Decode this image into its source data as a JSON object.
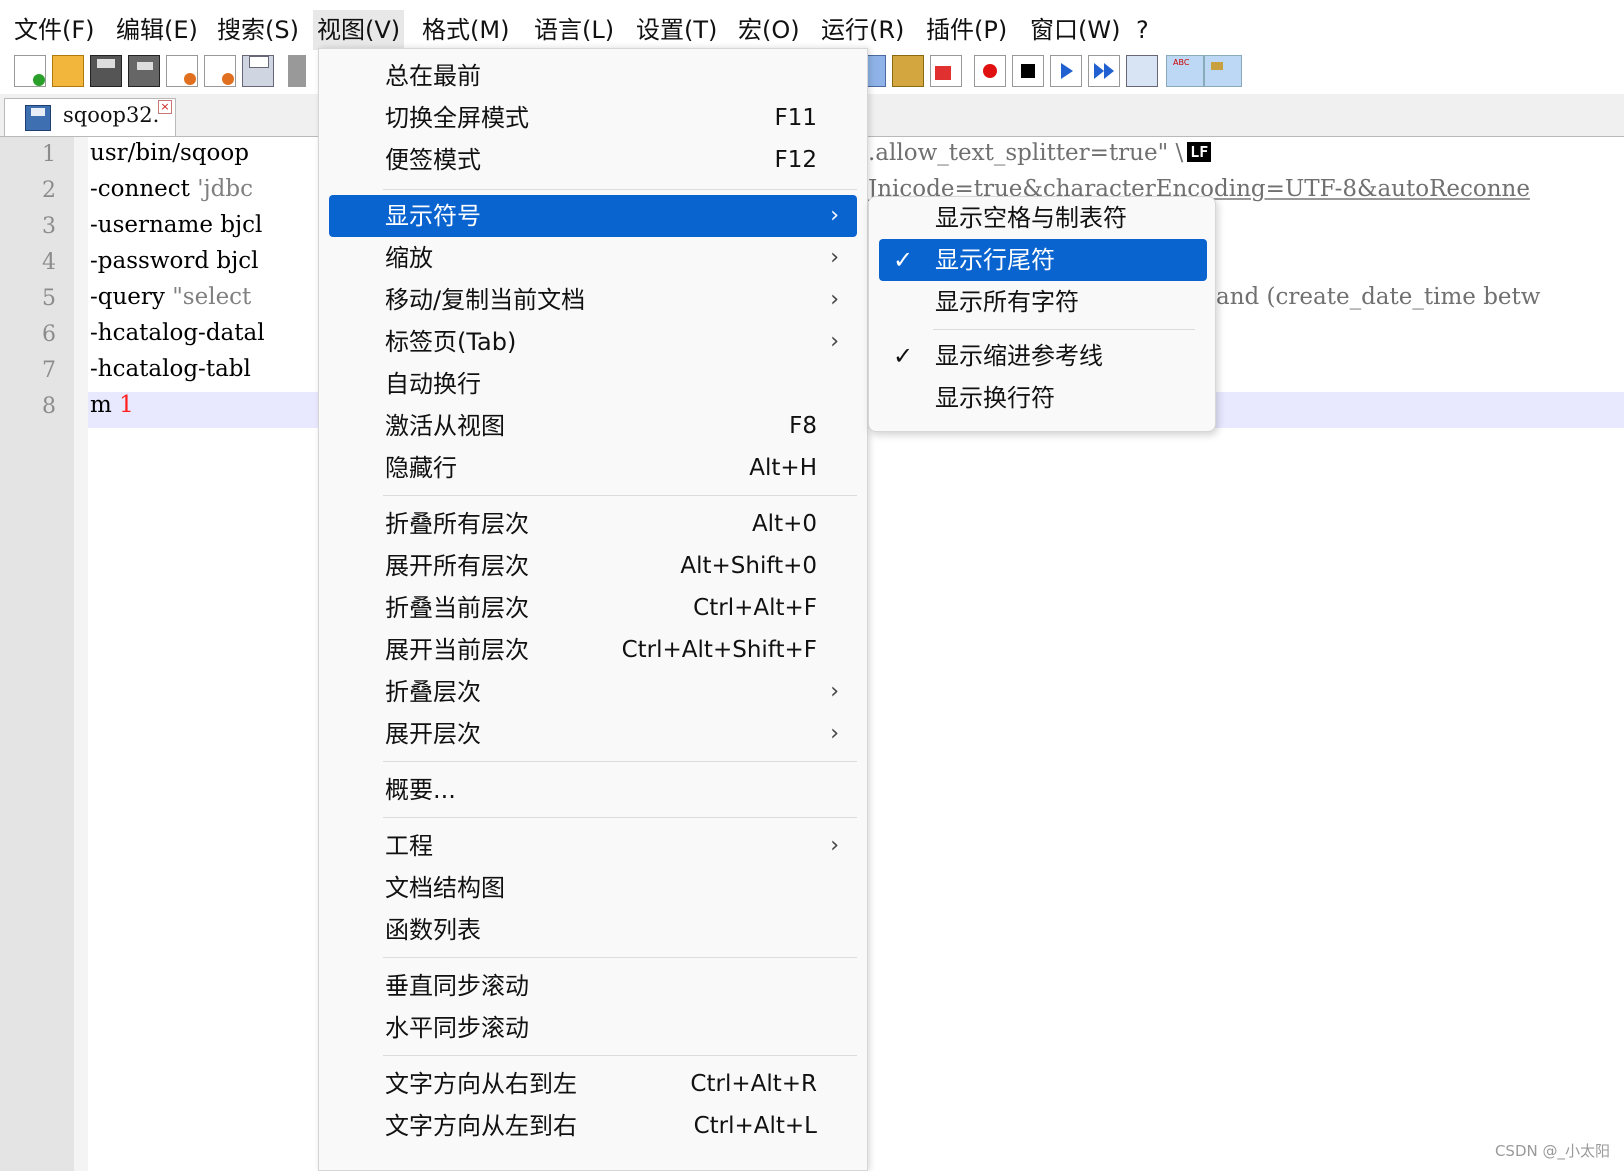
{
  "menubar": {
    "items": [
      "文件(F)",
      "编辑(E)",
      "搜索(S)",
      "视图(V)",
      "格式(M)",
      "语言(L)",
      "设置(T)",
      "宏(O)",
      "运行(R)",
      "插件(P)",
      "窗口(W)",
      "?"
    ]
  },
  "tab": {
    "name": "sqoop32."
  },
  "editor": {
    "line_numbers": [
      "1",
      "2",
      "3",
      "4",
      "5",
      "6",
      "7",
      "8"
    ],
    "lines": [
      {
        "a": "usr/bin/sqoop",
        "b": ""
      },
      {
        "a": "-connect ",
        "b": "'jdbc"
      },
      {
        "a": "-username bjcl",
        "b": ""
      },
      {
        "a": "-password bjcl",
        "b": ""
      },
      {
        "a": "-query ",
        "b": "\"select"
      },
      {
        "a": "-hcatalog-datal",
        "b": ""
      },
      {
        "a": "-hcatalog-tabl",
        "b": ""
      },
      {
        "a": "m ",
        "b": "1"
      }
    ],
    "right_line1": ".allow_text_splitter=true\" \\",
    "right_line1_badge": "LF",
    "right_line2": "Jnicode=true&characterEncoding=UTF-8&autoReconne",
    "right_line5": "and (create_date_time betw"
  },
  "view_menu": {
    "items": [
      {
        "label": "总在最前",
        "shortcut": ""
      },
      {
        "label": "切换全屏模式",
        "shortcut": "F11"
      },
      {
        "label": "便签模式",
        "shortcut": "F12"
      },
      {
        "label": "显示符号",
        "shortcut": ""
      },
      {
        "label": "缩放",
        "shortcut": ""
      },
      {
        "label": "移动/复制当前文档",
        "shortcut": ""
      },
      {
        "label": "标签页(Tab)",
        "shortcut": ""
      },
      {
        "label": "自动换行",
        "shortcut": ""
      },
      {
        "label": "激活从视图",
        "shortcut": "F8"
      },
      {
        "label": "隐藏行",
        "shortcut": "Alt+H"
      },
      {
        "label": "折叠所有层次",
        "shortcut": "Alt+0"
      },
      {
        "label": "展开所有层次",
        "shortcut": "Alt+Shift+0"
      },
      {
        "label": "折叠当前层次",
        "shortcut": "Ctrl+Alt+F"
      },
      {
        "label": "展开当前层次",
        "shortcut": "Ctrl+Alt+Shift+F"
      },
      {
        "label": "折叠层次",
        "shortcut": ""
      },
      {
        "label": "展开层次",
        "shortcut": ""
      },
      {
        "label": "概要...",
        "shortcut": ""
      },
      {
        "label": "工程",
        "shortcut": ""
      },
      {
        "label": "文档结构图",
        "shortcut": ""
      },
      {
        "label": "函数列表",
        "shortcut": ""
      },
      {
        "label": "垂直同步滚动",
        "shortcut": ""
      },
      {
        "label": "水平同步滚动",
        "shortcut": ""
      },
      {
        "label": "文字方向从右到左",
        "shortcut": "Ctrl+Alt+R"
      },
      {
        "label": "文字方向从左到右",
        "shortcut": "Ctrl+Alt+L"
      }
    ]
  },
  "symbol_submenu": {
    "items": [
      {
        "label": "显示空格与制表符",
        "checked": false
      },
      {
        "label": "显示行尾符",
        "checked": true
      },
      {
        "label": "显示所有字符",
        "checked": false
      },
      {
        "label": "显示缩进参考线",
        "checked": true
      },
      {
        "label": "显示换行符",
        "checked": false
      }
    ]
  },
  "glyphs": {
    "check": "✓",
    "arrow": "›",
    "close": "×"
  },
  "watermark": "CSDN @_小太阳",
  "colors": {
    "highlight": "#0a64d0",
    "current_line": "#e8e8ff"
  }
}
